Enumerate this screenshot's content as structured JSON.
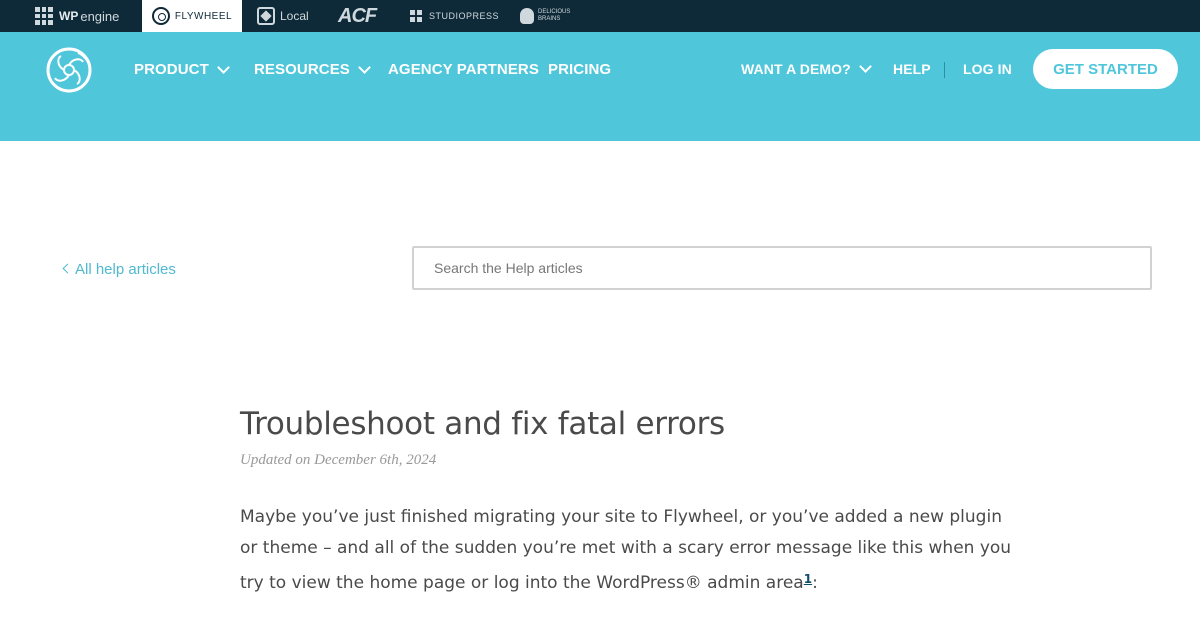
{
  "brandbar": {
    "wpengine_bold": "WP",
    "wpengine_rest": "engine",
    "flywheel": "FLYWHEEL",
    "local": "Local",
    "acf": "ACF",
    "studiopress": "STUDIOPRESS",
    "delicious_line1": "DELICIOUS",
    "delicious_line2": "BRAINS"
  },
  "header": {
    "nav": {
      "product": "PRODUCT",
      "resources": "RESOURCES",
      "agency": "AGENCY PARTNERS",
      "pricing": "PRICING",
      "demo": "WANT A DEMO?",
      "help": "HELP",
      "login": "LOG IN"
    },
    "cta": "GET STARTED",
    "brand_color": "#50c6db",
    "dark_color": "#0e2a38"
  },
  "help": {
    "back_label": "All help articles",
    "search_placeholder": "Search the Help articles"
  },
  "article": {
    "title": "Troubleshoot and fix fatal errors",
    "updated": "Updated on December 6th, 2024",
    "body_line1": "Maybe you’ve just finished migrating your site to Flywheel, or you’ve added a new plugin",
    "body_line2": "or theme – and all of the sudden you’re met with a scary error message like this when you",
    "body_line3": "try to view the home page or log into the WordPress® admin area",
    "footnote": "1",
    "body_line3_end": ":"
  }
}
